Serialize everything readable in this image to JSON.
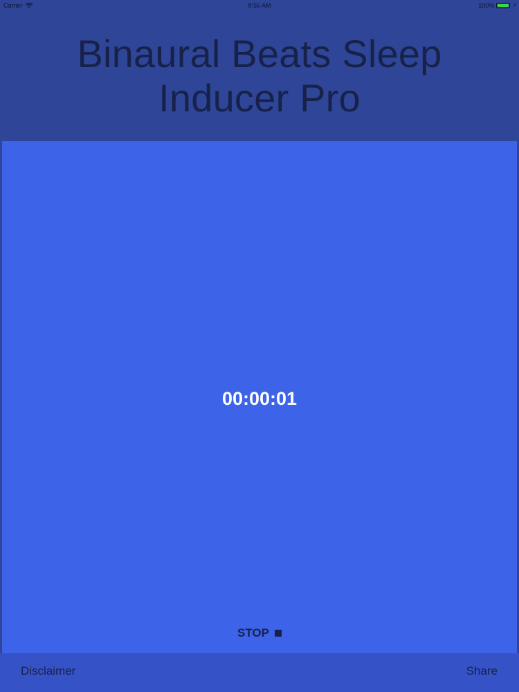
{
  "status_bar": {
    "carrier": "Carrier",
    "time": "8:56 AM",
    "battery": "100%",
    "wifi_icon": "wifi-icon",
    "battery_icon": "battery-icon",
    "battery_level": 1.0,
    "charge_icon": "charging-bolt-icon"
  },
  "header": {
    "title": "Binaural Beats Sleep Inducer Pro"
  },
  "main": {
    "timer": "00:00:01",
    "stop_label": "STOP",
    "stop_icon": "stop-square-icon"
  },
  "bottom_bar": {
    "left_link": "Disclaimer",
    "right_link": "Share"
  },
  "colors": {
    "header_bg": "#2f4597",
    "panel_bg": "#3d63e9",
    "bottom_bg": "#3552c7",
    "title_text": "#17224a",
    "timer_text": "#ffffff"
  }
}
